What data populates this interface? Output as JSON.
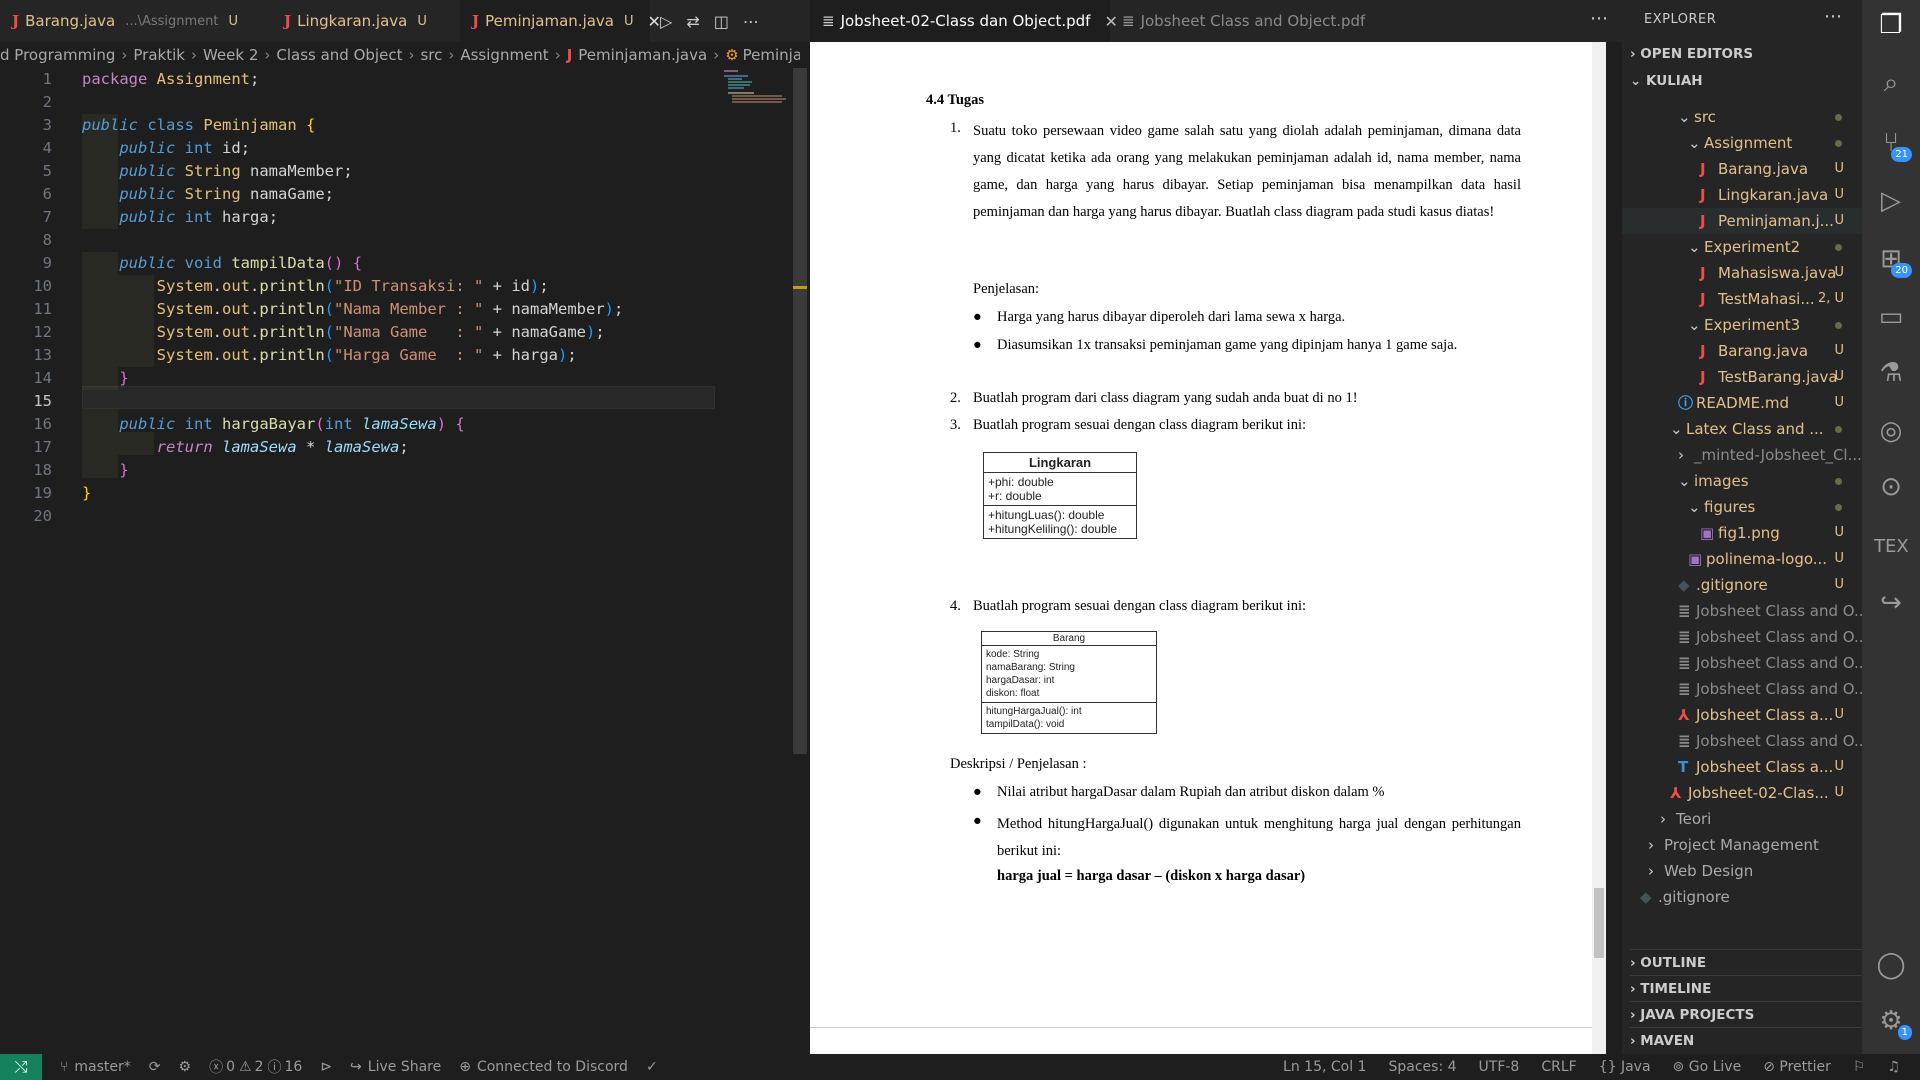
{
  "editor_tabs": [
    {
      "label": "Barang.java",
      "desc": "...\\Assignment",
      "status": "U"
    },
    {
      "label": "Lingkaran.java",
      "status": "U"
    },
    {
      "label": "Peminjaman.java",
      "status": "U"
    }
  ],
  "pdf_tabs": [
    {
      "label": "Jobsheet-02-Class dan Object.pdf"
    },
    {
      "label": "Jobsheet Class and Object.pdf"
    }
  ],
  "breadcrumb": [
    "d Programming",
    "Praktik",
    "Week 2",
    "Class and Object",
    "src",
    "Assignment",
    "Peminjaman.java",
    "Peminjaman"
  ],
  "code": {
    "line_numbers": [
      "1",
      "2",
      "3",
      "4",
      "5",
      "6",
      "7",
      "8",
      "9",
      "10",
      "11",
      "12",
      "13",
      "14",
      "15",
      "16",
      "17",
      "18",
      "19",
      "20"
    ],
    "l1": {
      "package": "package",
      "name": "Assignment"
    },
    "l3": {
      "public": "public",
      "class": "class",
      "name": "Peminjaman"
    },
    "l4": {
      "public": "public",
      "type": "int",
      "name": "id"
    },
    "l5": {
      "public": "public",
      "type": "String",
      "name": "namaMember"
    },
    "l6": {
      "public": "public",
      "type": "String",
      "name": "namaGame"
    },
    "l7": {
      "public": "public",
      "type": "int",
      "name": "harga"
    },
    "l9": {
      "public": "public",
      "void": "void",
      "fn": "tampilData"
    },
    "l10": {
      "sys": "System",
      "out": "out",
      "fn": "println",
      "str": "\"ID Transaksi: \"",
      "var": "id"
    },
    "l11": {
      "sys": "System",
      "out": "out",
      "fn": "println",
      "str": "\"Nama Member : \"",
      "var": "namaMember"
    },
    "l12": {
      "sys": "System",
      "out": "out",
      "fn": "println",
      "str": "\"Nama Game   : \"",
      "var": "namaGame"
    },
    "l13": {
      "sys": "System",
      "out": "out",
      "fn": "println",
      "str": "\"Harga Game  : \"",
      "var": "harga"
    },
    "l16": {
      "public": "public",
      "type": "int",
      "fn": "hargaBayar",
      "ptype": "int",
      "param": "lamaSewa"
    },
    "l17": {
      "ret": "return",
      "a": "lamaSewa",
      "b": "lamaSewa"
    }
  },
  "pdf": {
    "heading": "4.4 Tugas",
    "item1_num": "1.",
    "item1_text": "Suatu toko persewaan video game salah satu yang diolah adalah peminjaman, dimana data yang dicatat ketika ada orang yang melakukan peminjaman adalah id, nama member, nama game, dan harga yang harus dibayar. Setiap peminjaman bisa menampilkan data hasil peminjaman dan harga yang harus dibayar. Buatlah class diagram pada studi kasus diatas!",
    "penjelasan": "Penjelasan:",
    "bullets1": [
      "Harga yang harus dibayar diperoleh dari lama sewa x harga.",
      "Diasumsikan 1x transaksi peminjaman game yang dipinjam hanya 1 game saja."
    ],
    "item2_num": "2.",
    "item2_text": "Buatlah program dari class diagram yang sudah anda buat di no 1!",
    "item3_num": "3.",
    "item3_text": "Buatlah program sesuai dengan class diagram berikut ini:",
    "uml1": {
      "name": "Lingkaran",
      "attrs": [
        "+phi: double",
        "+r: double"
      ],
      "methods": [
        "+hitungLuas(): double",
        "+hitungKeliling(): double"
      ]
    },
    "item4_num": "4.",
    "item4_text": "Buatlah program sesuai dengan class diagram berikut ini:",
    "uml2": {
      "name": "Barang",
      "attrs": [
        "kode: String",
        "namaBarang: String",
        "hargaDasar: int",
        "diskon: float"
      ],
      "methods": [
        "hitungHargaJual(): int",
        "tampilData(): void"
      ]
    },
    "deskripsi": "Deskripsi / Penjelasan :",
    "bullets2": [
      "Nilai atribut hargaDasar dalam Rupiah dan atribut diskon dalam %",
      "Method hitungHargaJual() digunakan untuk menghitung harga jual dengan perhitungan berikut ini:"
    ],
    "formula": "harga jual = harga dasar – (diskon x harga dasar)"
  },
  "explorer": {
    "title": "EXPLORER",
    "open_editors": "OPEN EDITORS",
    "root": "KULIAH",
    "items": [
      {
        "label": "src",
        "status": ""
      },
      {
        "label": "Assignment",
        "status": ""
      },
      {
        "label": "Barang.java",
        "status": "U"
      },
      {
        "label": "Lingkaran.java",
        "status": "U"
      },
      {
        "label": "Peminjaman.j...",
        "status": "U"
      },
      {
        "label": "Experiment2",
        "status": ""
      },
      {
        "label": "Mahasiswa.java",
        "status": "U"
      },
      {
        "label": "TestMahasi...",
        "status": "2, U"
      },
      {
        "label": "Experiment3",
        "status": ""
      },
      {
        "label": "Barang.java",
        "status": "U"
      },
      {
        "label": "TestBarang.java",
        "status": "U"
      },
      {
        "label": "README.md",
        "status": "U"
      },
      {
        "label": "Latex Class and ...",
        "status": ""
      },
      {
        "label": "_minted-Jobsheet_Cl...",
        "status": ""
      },
      {
        "label": "images",
        "status": ""
      },
      {
        "label": "figures",
        "status": ""
      },
      {
        "label": "fig1.png",
        "status": "U"
      },
      {
        "label": "polinema-logo...",
        "status": "U"
      },
      {
        "label": ".gitignore",
        "status": "U"
      },
      {
        "label": "Jobsheet Class and O...",
        "status": ""
      },
      {
        "label": "Jobsheet Class and O...",
        "status": ""
      },
      {
        "label": "Jobsheet Class and O...",
        "status": ""
      },
      {
        "label": "Jobsheet Class and O...",
        "status": ""
      },
      {
        "label": "Jobsheet Class a...",
        "status": "U"
      },
      {
        "label": "Jobsheet Class and O...",
        "status": ""
      },
      {
        "label": "Jobsheet Class a...",
        "status": "U"
      },
      {
        "label": "Jobsheet-02-Clas...",
        "status": "U"
      },
      {
        "label": "Teori",
        "status": ""
      },
      {
        "label": "Project Management",
        "status": ""
      },
      {
        "label": "Web Design",
        "status": ""
      },
      {
        "label": ".gitignore",
        "status": ""
      }
    ],
    "sections": [
      "OUTLINE",
      "TIMELINE",
      "JAVA PROJECTS",
      "MAVEN"
    ]
  },
  "activity": {
    "scm_badge": "21",
    "ext_badge": "20",
    "settings_badge": "1",
    "tex": "TEX"
  },
  "status": {
    "branch": "master*",
    "errors": "0",
    "warnings": "2",
    "infos": "16",
    "live_share": "Live Share",
    "discord": "Connected to Discord",
    "position": "Ln 15, Col 1",
    "spaces": "Spaces: 4",
    "encoding": "UTF-8",
    "eol": "CRLF",
    "language": "Java",
    "golive": "Go Live",
    "prettier": "Prettier"
  }
}
